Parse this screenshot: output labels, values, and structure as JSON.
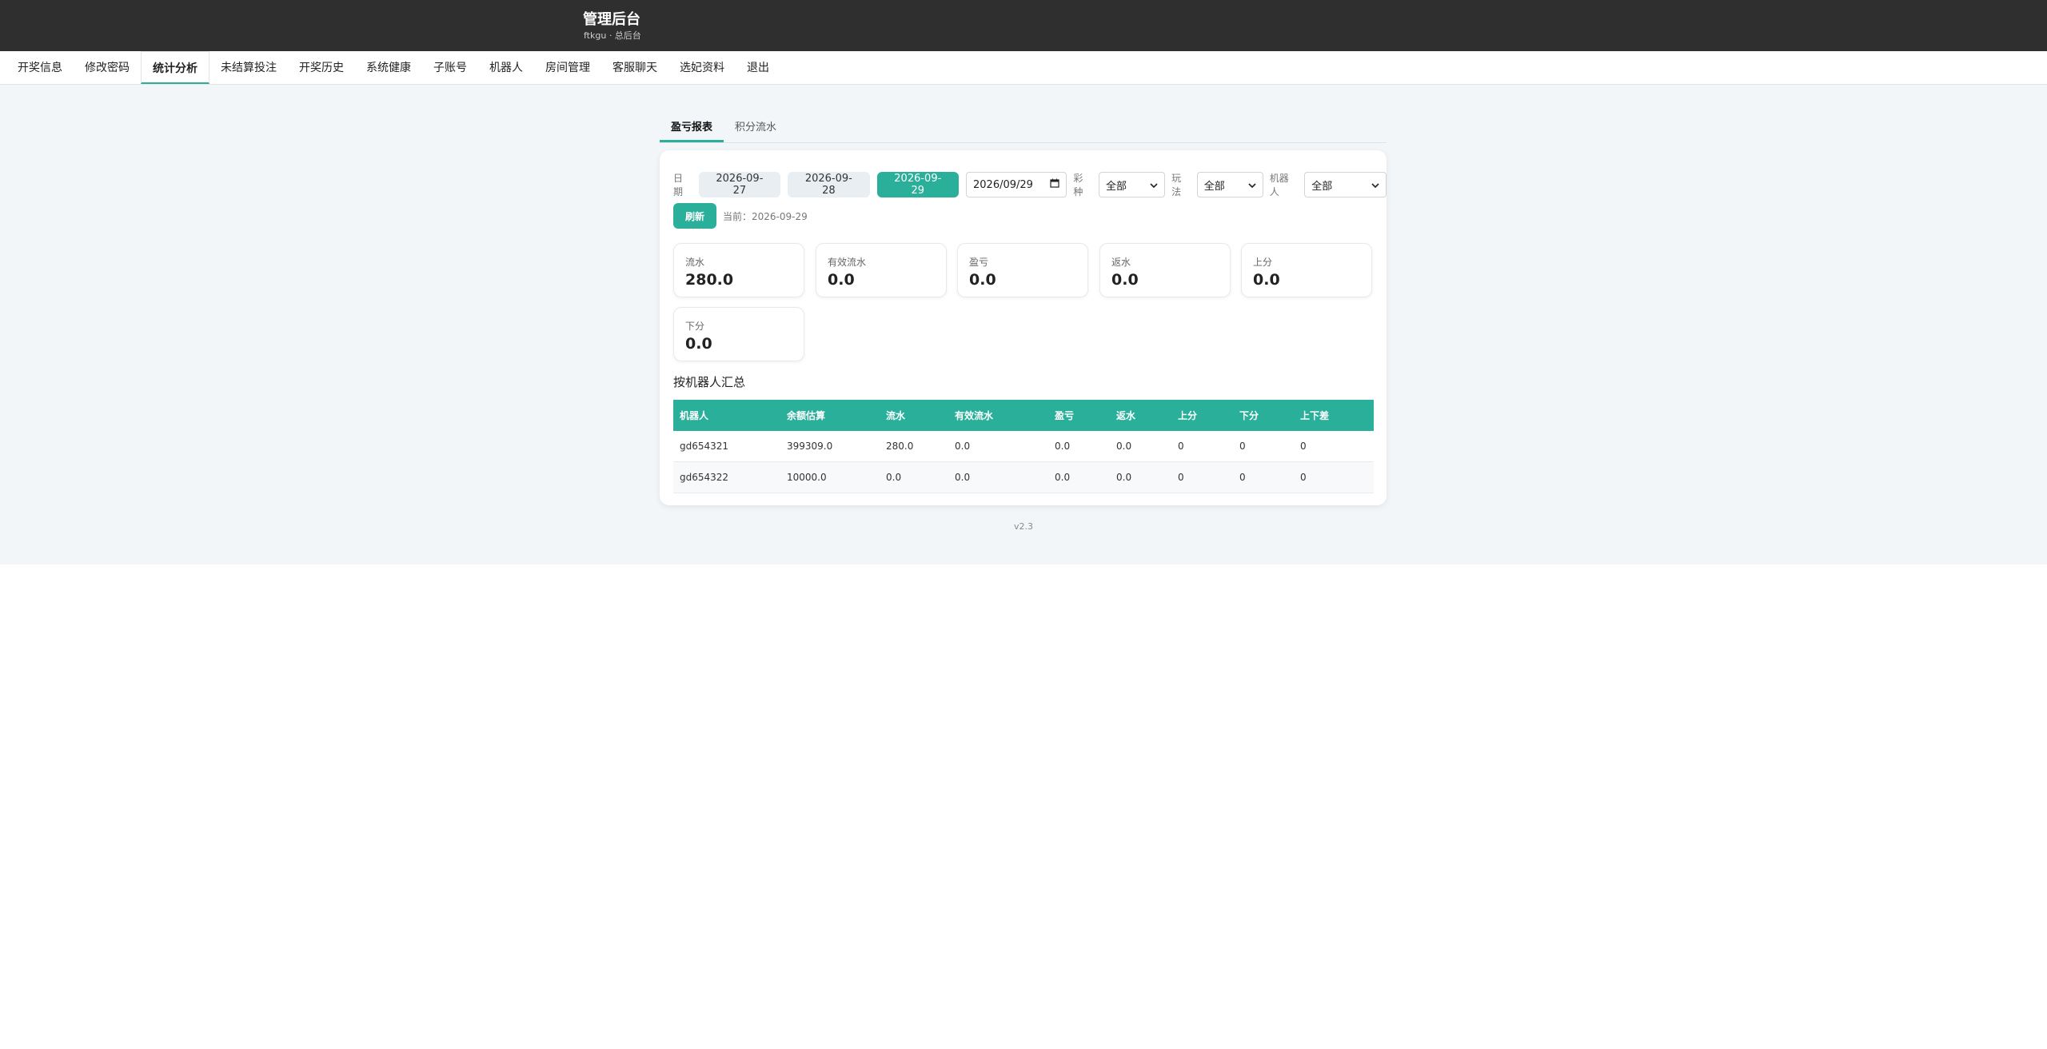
{
  "header": {
    "title": "管理后台",
    "subtitle": "ftkgu · 总后台"
  },
  "nav": [
    {
      "label": "开奖信息"
    },
    {
      "label": "修改密码"
    },
    {
      "label": "统计分析",
      "active": true
    },
    {
      "label": "未结算投注"
    },
    {
      "label": "开奖历史"
    },
    {
      "label": "系统健康"
    },
    {
      "label": "子账号"
    },
    {
      "label": "机器人"
    },
    {
      "label": "房间管理"
    },
    {
      "label": "客服聊天"
    },
    {
      "label": "选妃资料"
    },
    {
      "label": "退出"
    }
  ],
  "subtabs": [
    {
      "label": "盈亏报表",
      "active": true
    },
    {
      "label": "积分流水"
    }
  ],
  "filters": {
    "date_label": "日期",
    "date_buttons": [
      "2026-09-27",
      "2026-09-28",
      "2026-09-29"
    ],
    "active_date": "2026-09-29",
    "date_input_value": "2026/09/29",
    "lottery_label": "彩种",
    "lottery_value": "全部",
    "play_label": "玩法",
    "play_value": "全部",
    "robot_label": "机器人",
    "robot_value": "全部",
    "refresh_label": "刷新",
    "current_text": "当前：2026-09-29"
  },
  "stats": [
    {
      "label": "流水",
      "value": "280.0"
    },
    {
      "label": "有效流水",
      "value": "0.0"
    },
    {
      "label": "盈亏",
      "value": "0.0"
    },
    {
      "label": "返水",
      "value": "0.0"
    },
    {
      "label": "上分",
      "value": "0.0"
    },
    {
      "label": "下分",
      "value": "0.0"
    }
  ],
  "summary": {
    "title": "按机器人汇总",
    "columns": [
      "机器人",
      "余额估算",
      "流水",
      "有效流水",
      "盈亏",
      "返水",
      "上分",
      "下分",
      "上下差"
    ],
    "rows": [
      [
        "gd654321",
        "399309.0",
        "280.0",
        "0.0",
        "0.0",
        "0.0",
        "0",
        "0",
        "0"
      ],
      [
        "gd654322",
        "10000.0",
        "0.0",
        "0.0",
        "0.0",
        "0.0",
        "0",
        "0",
        "0"
      ]
    ]
  },
  "footer": {
    "version": "v2.3"
  },
  "colors": {
    "accent": "#2ab09a",
    "topbar": "#2f2f2f",
    "background": "#f3f6f8"
  },
  "icons": {
    "date_picker": "calendar-icon",
    "select": "chevron-down-icon"
  }
}
